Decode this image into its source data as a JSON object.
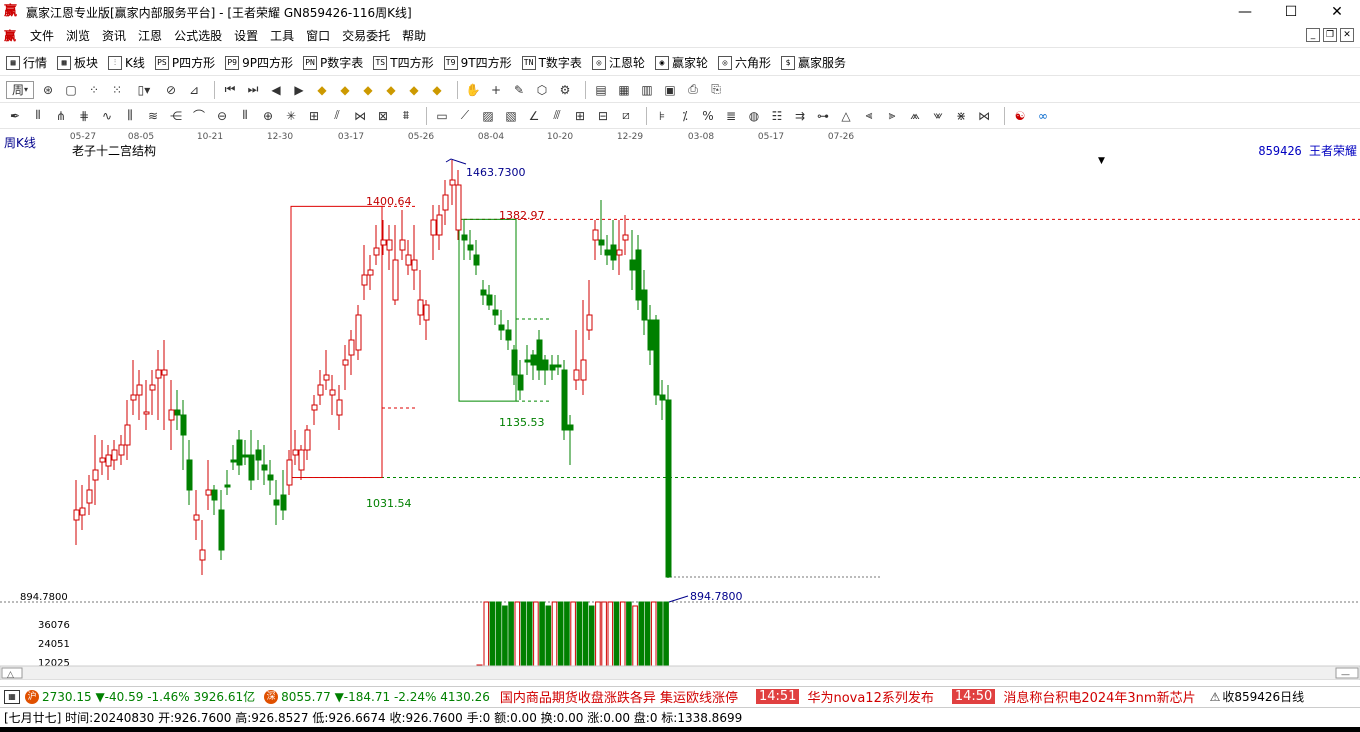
{
  "window": {
    "title": "赢家江恩专业版[赢家内部服务平台] - [王者荣耀   GN859426-116周K线]",
    "min": "—",
    "max": "☐",
    "close": "✕"
  },
  "menu": [
    "文件",
    "浏览",
    "资讯",
    "江恩",
    "公式选股",
    "设置",
    "工具",
    "窗口",
    "交易委托",
    "帮助"
  ],
  "toolbar1": [
    {
      "icon": "grid-icon",
      "glyph": "▦",
      "label": "行情"
    },
    {
      "icon": "blocks-icon",
      "glyph": "▩",
      "label": "板块"
    },
    {
      "icon": "kline-icon",
      "glyph": "⫶",
      "label": "K线"
    },
    {
      "icon": "ps-icon",
      "glyph": "PS",
      "label": "P四方形"
    },
    {
      "icon": "p9-icon",
      "glyph": "P9",
      "label": "9P四方形"
    },
    {
      "icon": "pn-icon",
      "glyph": "PN",
      "label": "P数字表"
    },
    {
      "icon": "ts-icon",
      "glyph": "TS",
      "label": "T四方形"
    },
    {
      "icon": "t9-icon",
      "glyph": "T9",
      "label": "9T四方形"
    },
    {
      "icon": "tn-icon",
      "glyph": "TN",
      "label": "T数字表"
    },
    {
      "icon": "gann-wheel-icon",
      "glyph": "◎",
      "label": "江恩轮"
    },
    {
      "icon": "winner-wheel-icon",
      "glyph": "◉",
      "label": "赢家轮"
    },
    {
      "icon": "hexagon-icon",
      "glyph": "◎",
      "label": "六角形"
    },
    {
      "icon": "dollar-icon",
      "glyph": "$",
      "label": "赢家服务"
    }
  ],
  "period_button": "周",
  "chart": {
    "period_label": "周K线",
    "indicator_name": "老子十二宫结构",
    "stock_info": "859426  王者荣耀",
    "date_ticks": [
      "05-27",
      "08-05",
      "10-21",
      "12-30",
      "03-17",
      "05-26",
      "08-04",
      "10-20",
      "12-29",
      "03-08",
      "05-17",
      "07-26"
    ],
    "annotations": {
      "high": "1463.7300",
      "box1_top": "1400.64",
      "box1_bottom": "1031.54",
      "box2_top": "1382.97",
      "box2_bottom": "1135.53",
      "low": "894.7800"
    },
    "volume_axis": {
      "price_label": "894.7800",
      "ticks": [
        "36076",
        "24051",
        "12025"
      ]
    }
  },
  "chart_data": {
    "type": "candlestick",
    "title": "王者荣耀 GN859426 周K线",
    "ylim": [
      894.78,
      1463.73
    ],
    "levels": [
      {
        "label": "1463.7300",
        "value": 1463.73
      },
      {
        "label": "1400.64",
        "value": 1400.64
      },
      {
        "label": "1382.97",
        "value": 1382.97
      },
      {
        "label": "1135.53",
        "value": 1135.53
      },
      {
        "label": "1031.54",
        "value": 1031.54
      },
      {
        "label": "894.7800",
        "value": 894.78
      }
    ],
    "volume_ticks": [
      12025,
      24051,
      36076
    ]
  },
  "status1": {
    "idx1_value": "2730.15",
    "idx1_change": "▼-40.59",
    "idx1_pct": "-1.46%",
    "idx1_amount": "3926.61亿",
    "idx2_value": "8055.77",
    "idx2_change": "▼-184.71",
    "idx2_pct": "-2.24%",
    "idx2_amount": "4130.26",
    "news1": "国内商品期货收盘涨跌各异 集运欧线涨停",
    "news2_time": "14:51",
    "news2": "华为nova12系列发布",
    "news3_time": "14:50",
    "news3": "消息称台积电2024年3nm新芯片",
    "right_text": "收859426日线"
  },
  "status2": {
    "text": "[七月廿七] 时间:20240830 开:926.7600 高:926.8527 低:926.6674 收:926.7600 手:0 额:0.00 换:0.00 涨:0.00 盘:0 标:1338.8699"
  }
}
